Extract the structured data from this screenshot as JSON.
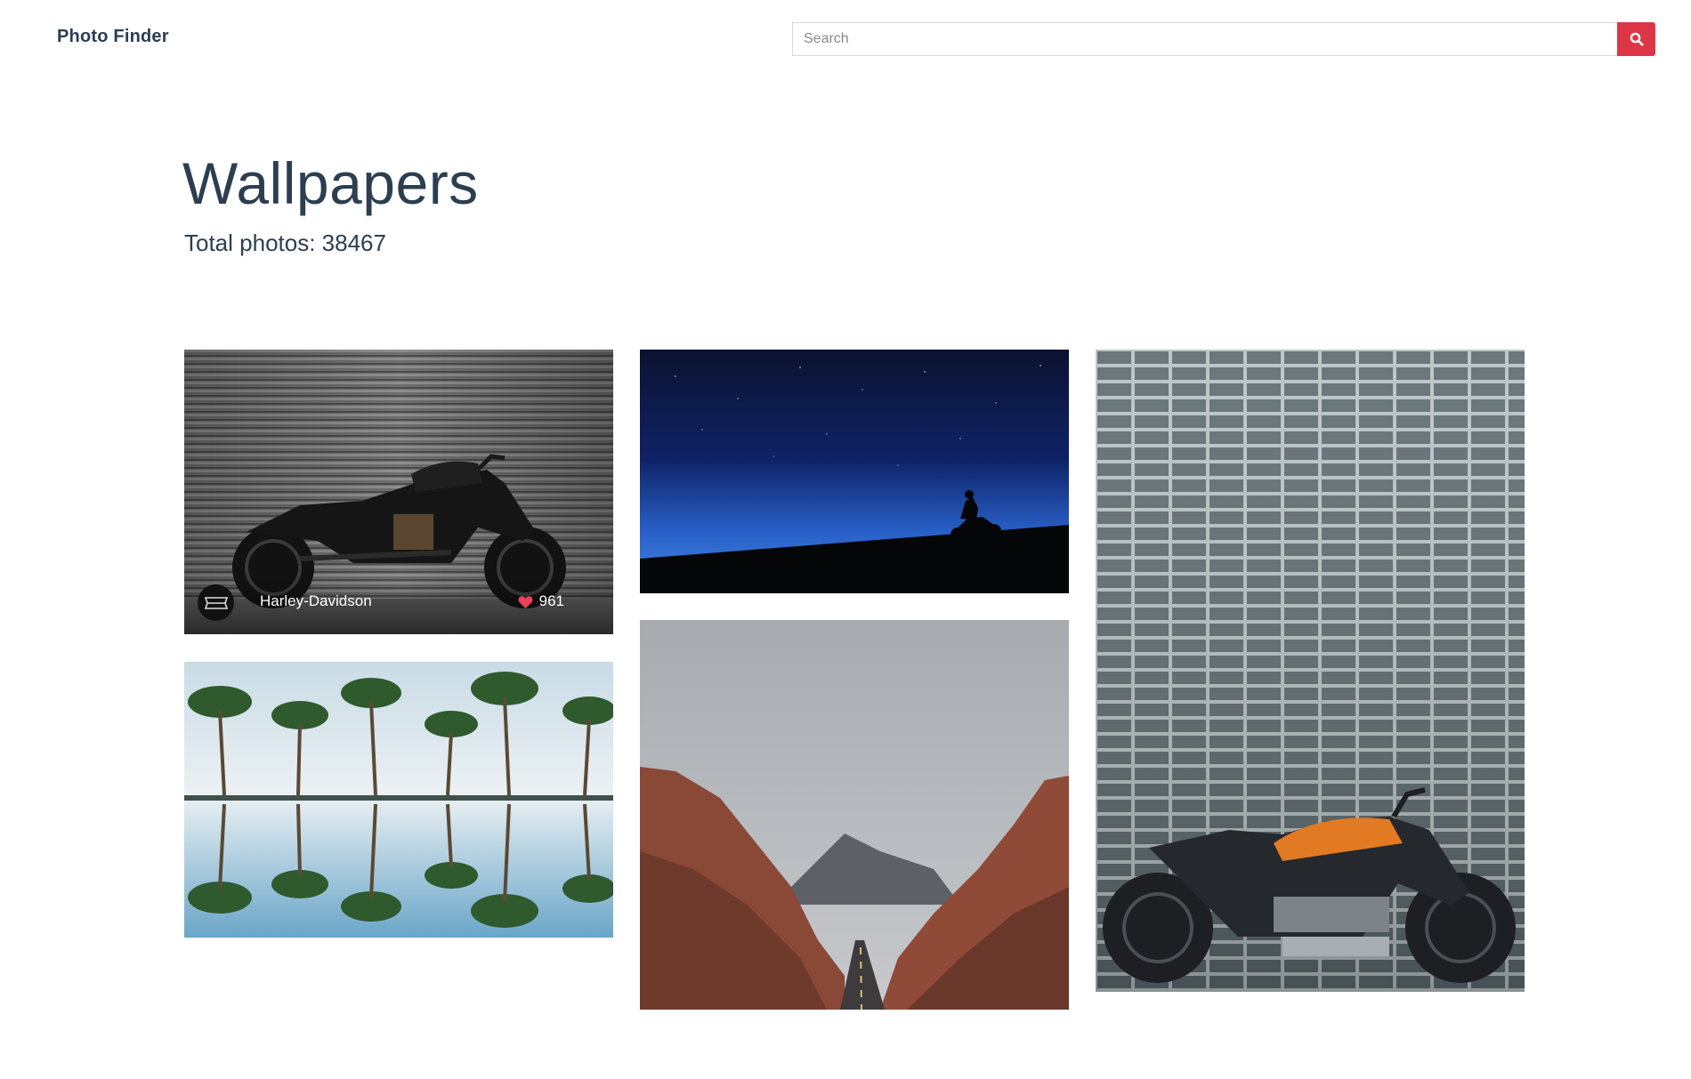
{
  "header": {
    "brand": "Photo Finder",
    "search": {
      "placeholder": "Search",
      "value": ""
    },
    "search_button_icon": "search-icon"
  },
  "page": {
    "title": "Wallpapers",
    "total_photos": "Total photos: 38467"
  },
  "colors": {
    "accent": "#dc3545",
    "text": "#2c3e50"
  },
  "photos": [
    {
      "subject": "Black motorcycle in front of a metal shutter",
      "user": "Harley-Davidson",
      "likes": "961",
      "avatar_icon": "harley-logo-icon",
      "heart_icon": "heart-icon"
    },
    {
      "subject": "Motorcyclist silhouette under a starry night sky"
    },
    {
      "subject": "Gray tiled wall with orange electric motorcycle"
    },
    {
      "subject": "Palm trees reflected in water"
    },
    {
      "subject": "Road through red rock canyon"
    }
  ]
}
